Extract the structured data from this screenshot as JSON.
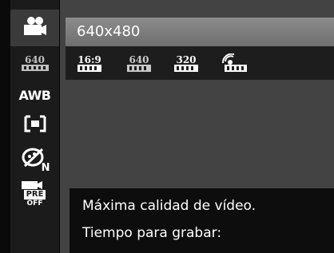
{
  "sidebar": {
    "items": [
      {
        "name": "video-mode",
        "icon": "video-camera-icon",
        "active": true
      },
      {
        "name": "resolution",
        "label": "640",
        "icon": "film-resolution-icon"
      },
      {
        "name": "white-balance",
        "label": "AWB"
      },
      {
        "name": "metering",
        "icon": "metering-frame-icon"
      },
      {
        "name": "color-effect",
        "icon": "color-effect-icon",
        "badge": "N"
      },
      {
        "name": "pre-record",
        "label": "PRE",
        "sub": "OFF",
        "icon": "pre-record-icon"
      }
    ]
  },
  "main": {
    "selected_title": "640x480",
    "options": [
      {
        "label": "16:9",
        "icon": "film-icon"
      },
      {
        "label": "640",
        "icon": "film-icon",
        "dim": true
      },
      {
        "label": "320",
        "icon": "film-icon"
      },
      {
        "label": "",
        "icon": "web-video-icon"
      }
    ],
    "description_line1": "Máxima calidad de vídeo.",
    "description_line2": "Tiempo para grabar:"
  },
  "colors": {
    "accent_bar": "#7e7e7e",
    "panel": "#434343",
    "sidebar": "#1b1b1b"
  }
}
